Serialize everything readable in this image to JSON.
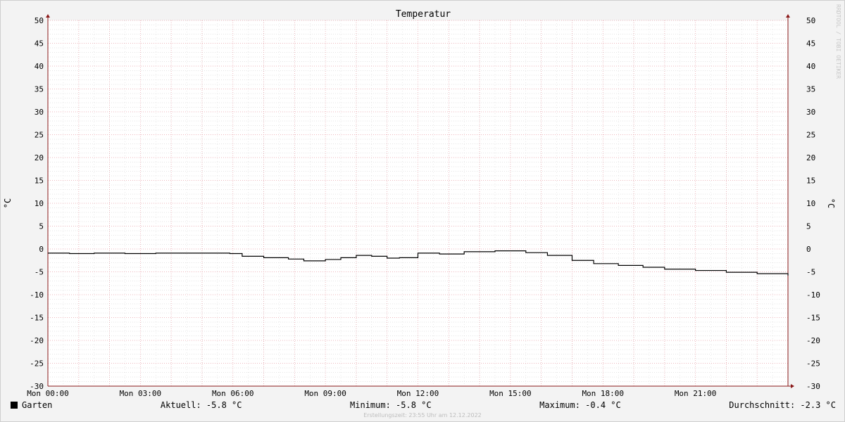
{
  "chart_data": {
    "type": "line",
    "title": "Temperatur",
    "ylabel": "°C",
    "xlabel": "",
    "ylim": [
      -30,
      50
    ],
    "y_ticks": [
      -30,
      -25,
      -20,
      -15,
      -10,
      -5,
      0,
      5,
      10,
      15,
      20,
      25,
      30,
      35,
      40,
      45,
      50
    ],
    "x_range_hours": [
      0,
      24
    ],
    "x_ticks": [
      {
        "hour": 0,
        "label": "Mon 00:00"
      },
      {
        "hour": 3,
        "label": "Mon 03:00"
      },
      {
        "hour": 6,
        "label": "Mon 06:00"
      },
      {
        "hour": 9,
        "label": "Mon 09:00"
      },
      {
        "hour": 12,
        "label": "Mon 12:00"
      },
      {
        "hour": 15,
        "label": "Mon 15:00"
      },
      {
        "hour": 18,
        "label": "Mon 18:00"
      },
      {
        "hour": 21,
        "label": "Mon 21:00"
      }
    ],
    "grid": true,
    "legend_position": "bottom-left",
    "series": [
      {
        "name": "Garten",
        "color": "#000000",
        "x": [
          0,
          0.7,
          1.5,
          2.5,
          3.5,
          4.5,
          5.5,
          5.9,
          6.3,
          7.0,
          7.8,
          8.3,
          9.0,
          9.5,
          10.0,
          10.5,
          11.0,
          11.4,
          12.0,
          12.7,
          13.5,
          14.5,
          15.5,
          16.2,
          17.0,
          17.7,
          18.5,
          19.3,
          20.0,
          21.0,
          22.0,
          23.0,
          24.0
        ],
        "y": [
          -0.9,
          -1.0,
          -0.9,
          -1.0,
          -0.9,
          -0.9,
          -0.9,
          -1.0,
          -1.6,
          -1.9,
          -2.2,
          -2.6,
          -2.3,
          -1.9,
          -1.4,
          -1.6,
          -2.0,
          -1.9,
          -0.9,
          -1.1,
          -0.6,
          -0.4,
          -0.8,
          -1.4,
          -2.5,
          -3.2,
          -3.6,
          -4.0,
          -4.4,
          -4.7,
          -5.1,
          -5.4,
          -5.8
        ]
      }
    ]
  },
  "axis_right_unit": "°C",
  "watermark": "RRDTOOL / TOBI OETIKER",
  "legend": {
    "series_label": "Garten",
    "aktuell": "Aktuell: -5.8 °C",
    "minimum": "Minimum: -5.8 °C",
    "maximum": "Maximum: -0.4 °C",
    "durchschnitt": "Durchschnitt: -2.3 °C"
  },
  "footer": "Erstellungszeit: 23:55 Uhr am 12.12.2022",
  "colors": {
    "major_grid": "#e8a0a8",
    "minor_grid": "#c8c8c8",
    "axis_arrow": "#8b1a1a",
    "line": "#000000",
    "background": "#f3f3f3",
    "plot_background": "#ffffff"
  }
}
